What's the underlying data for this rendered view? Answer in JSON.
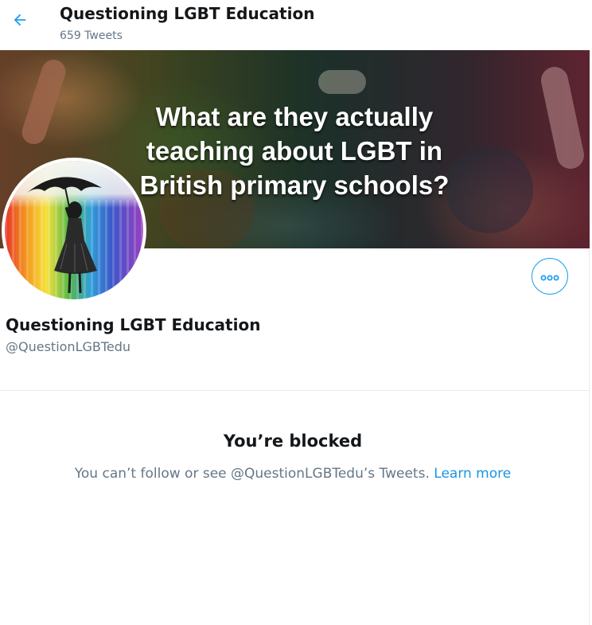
{
  "header": {
    "title": "Questioning LGBT Education",
    "tweet_count": "659 Tweets",
    "back_icon": "arrow-left-icon"
  },
  "banner": {
    "lines": [
      "What are they actually",
      "teaching about LGBT in",
      "British primary schools?"
    ]
  },
  "profile": {
    "name": "Questioning LGBT Education",
    "handle": "@QuestionLGBTedu",
    "more_icon": "more-icon"
  },
  "blocked": {
    "title": "You’re blocked",
    "message": "You can’t follow or see @QuestionLGBTedu’s Tweets.",
    "learn_more": "Learn more"
  },
  "colors": {
    "accent": "#1da1f2",
    "link": "#1b95e0",
    "text_primary": "#14171a",
    "text_secondary": "#657786",
    "divider": "#e6ecf0"
  }
}
